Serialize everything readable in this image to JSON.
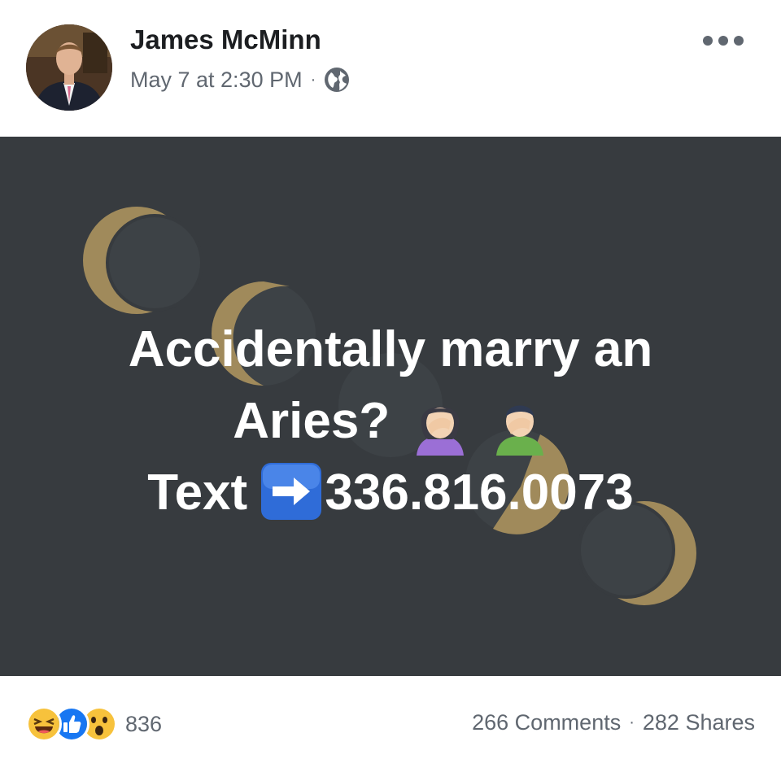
{
  "post": {
    "author": "James McMinn",
    "timestamp": "May 7 at 2:30 PM",
    "separator": "·",
    "privacy_icon": "globe-icon",
    "menu_icon": "more-options-icon",
    "content": {
      "line1": "Accidentally marry an",
      "line2": "Aries?",
      "line2_emojis": [
        "woman-facepalming-emoji",
        "man-facepalming-emoji"
      ],
      "line3_prefix": "Text",
      "line3_arrow_icon": "right-arrow-emoji",
      "phone": "336.816.0073",
      "background_color": "#373b3f",
      "moon_color": "#a08a5b"
    }
  },
  "footer": {
    "reactions": [
      "haha-icon",
      "like-icon",
      "wow-icon"
    ],
    "reaction_count": "836",
    "comments": "266 Comments",
    "separator": "·",
    "shares": "282 Shares"
  }
}
